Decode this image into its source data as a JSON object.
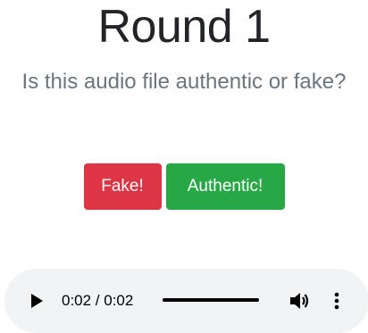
{
  "header": {
    "title": "Round 1",
    "subtitle": "Is this audio file authentic or fake?"
  },
  "actions": {
    "fake_label": "Fake!",
    "authentic_label": "Authentic!"
  },
  "audio_player": {
    "time_display": "0:02 / 0:02",
    "progress": 1.0,
    "icons": {
      "play": "play-icon",
      "volume": "volume-icon",
      "menu": "more-vert-icon"
    }
  },
  "colors": {
    "fake_button": "#dc3545",
    "authentic_button": "#28a745",
    "title": "#222428",
    "subtitle": "#6c757d",
    "player_background": "#f1f3f4"
  }
}
